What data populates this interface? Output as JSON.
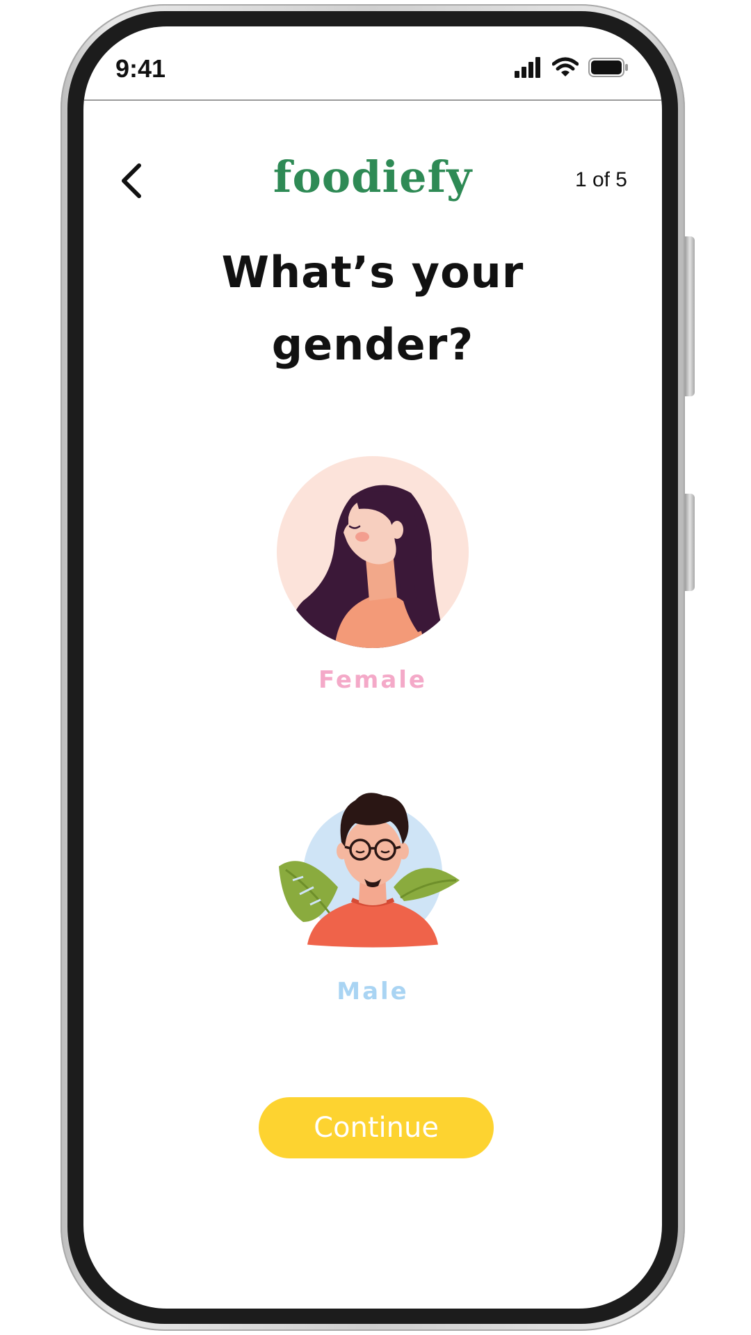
{
  "status_bar": {
    "time": "9:41",
    "icons": [
      "signal-icon",
      "wifi-icon",
      "battery-icon"
    ]
  },
  "header": {
    "back_icon": "chevron-left-icon",
    "brand": "foodiefy",
    "step": "1 of 5"
  },
  "question": {
    "line1": "What’s your",
    "line2": "gender?"
  },
  "options": [
    {
      "label": "Female",
      "color": "#f4a9c8",
      "avatar": "female-avatar"
    },
    {
      "label": "Male",
      "color": "#a9d4f3",
      "avatar": "male-avatar"
    }
  ],
  "continue_label": "Continue",
  "colors": {
    "brand": "#2e8a55",
    "button": "#fdd330",
    "female_bg": "#fce3da",
    "male_bg": "#cfe4f6"
  }
}
